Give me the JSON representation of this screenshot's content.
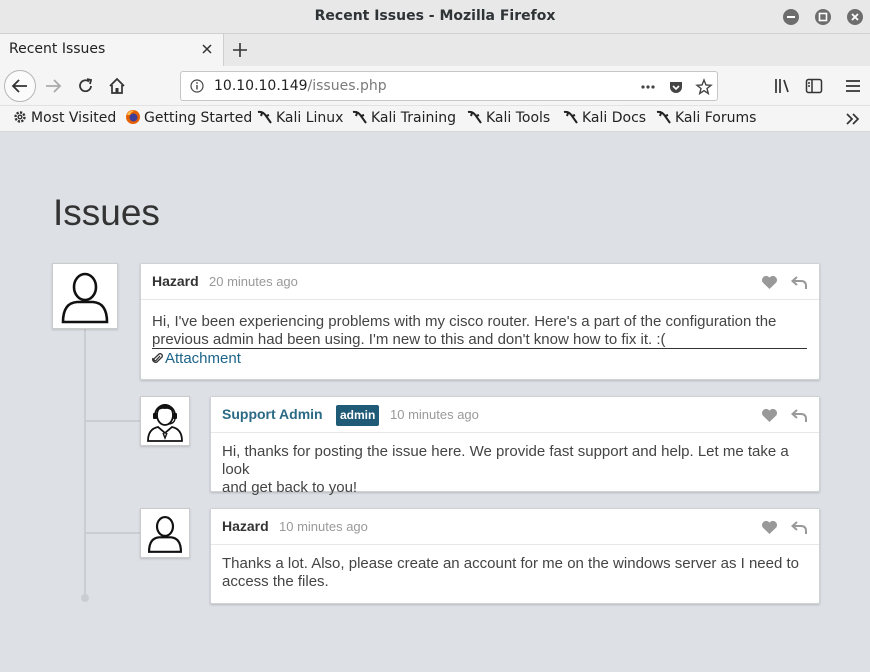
{
  "window": {
    "title": "Recent Issues - Mozilla Firefox"
  },
  "tabs": [
    {
      "label": "Recent Issues"
    }
  ],
  "navbar": {
    "url_host": "10.10.10.149",
    "url_path": "/issues.php"
  },
  "bookmarks": [
    {
      "label": "Most Visited",
      "icon": "gear-icon"
    },
    {
      "label": "Getting Started",
      "icon": "firefox-icon"
    },
    {
      "label": "Kali Linux",
      "icon": "kali-dragon-icon"
    },
    {
      "label": "Kali Training",
      "icon": "kali-dragon-icon"
    },
    {
      "label": "Kali Tools",
      "icon": "kali-dragon-icon"
    },
    {
      "label": "Kali Docs",
      "icon": "kali-dragon-icon"
    },
    {
      "label": "Kali Forums",
      "icon": "kali-dragon-icon"
    }
  ],
  "page": {
    "heading": "Issues",
    "posts": [
      {
        "author": "Hazard",
        "time": "20 minutes ago",
        "line1": "Hi, I've been experiencing problems with my cisco router. Here's a part of the configuration the",
        "line2": "previous admin had been using. I'm new to this and don't know how to fix it. :(",
        "attachment": "Attachment",
        "avatar": "user-avatar-icon"
      },
      {
        "author": "Support Admin",
        "badge": "admin",
        "time": "10 minutes ago",
        "line1": "Hi, thanks for posting the issue here. We provide fast support and help. Let me take a look",
        "line2": "and get back to you!",
        "avatar": "support-agent-avatar-icon"
      },
      {
        "author": "Hazard",
        "time": "10 minutes ago",
        "line1": "Thanks a lot. Also, please create an account for me on the windows server as I need to",
        "line2": "access the files.",
        "avatar": "user-avatar-icon"
      }
    ]
  },
  "colors": {
    "page_bg": "#dde1e6",
    "admin_name": "#2b6a85",
    "admin_badge": "#1f5b76",
    "link": "#1d6489"
  }
}
